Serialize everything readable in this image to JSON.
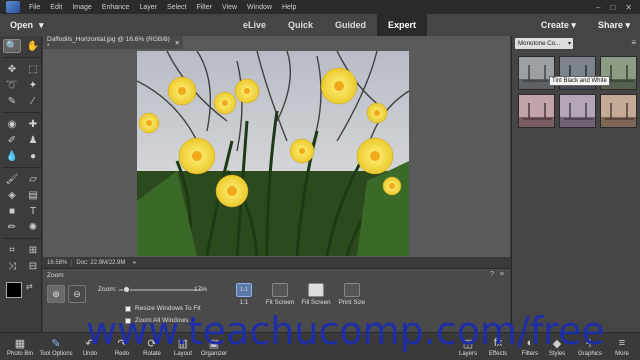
{
  "menubar": {
    "items": [
      "File",
      "Edit",
      "Image",
      "Enhance",
      "Layer",
      "Select",
      "Filter",
      "View",
      "Window",
      "Help"
    ]
  },
  "modebar": {
    "open_label": "Open",
    "tabs": [
      "eLive",
      "Quick",
      "Guided",
      "Expert"
    ],
    "active_tab": "Expert",
    "create_label": "Create",
    "share_label": "Share"
  },
  "document": {
    "tab_title": "Daffodils_Horizontal.jpg @ 16.6% (RGB/8) *",
    "status_zoom": "16.58%",
    "status_doc": "Doc: 22.9M/22.9M"
  },
  "tool_options": {
    "title": "Zoom",
    "zoom_label": "Zoom:",
    "zoom_value": "17%",
    "zoom_level": 0.17,
    "check_resize": "Resize Windows To Fit",
    "check_zoom_all": "Zoom All Windows",
    "btn_1to1_icon": "1:1",
    "btn_1to1": "1:1",
    "btn_fit": "Fit Screen",
    "btn_fill": "Fill Screen",
    "btn_print": "Print Size"
  },
  "right_panel": {
    "dropdown_value": "Monotone Co...",
    "tooltip": "Tint Black and White"
  },
  "bottom_bar": {
    "photo_bin": "Photo Bin",
    "tool_options": "Tool Options",
    "undo": "Undo",
    "redo": "Redo",
    "rotate": "Rotate",
    "layout": "Layout",
    "organizer": "Organizer",
    "layers": "Layers",
    "effects": "Effects",
    "filters": "Filters",
    "styles": "Styles",
    "graphics": "Graphics",
    "more": "More"
  },
  "watermark": "www.teachucomp.com/free"
}
